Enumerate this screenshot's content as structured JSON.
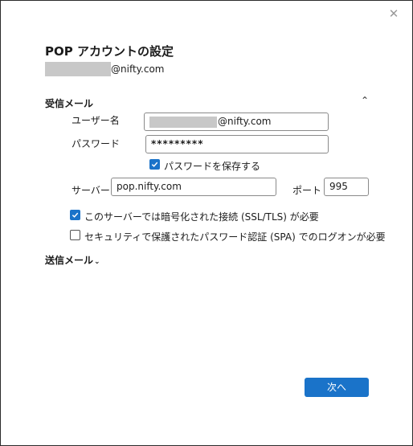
{
  "dialog": {
    "title": "POP アカウントの設定",
    "email_suffix": "@nifty.com"
  },
  "incoming": {
    "heading": "受信メール",
    "username_label": "ユーザー名",
    "username_suffix": "@nifty.com",
    "password_label": "パスワード",
    "password_value": "*********",
    "save_password_label": "パスワードを保存する",
    "save_password_checked": true,
    "server_label": "サーバー",
    "server_value": "pop.nifty.com",
    "port_label": "ポート",
    "port_value": "995",
    "ssl_label": "このサーバーでは暗号化された接続 (SSL/TLS) が必要",
    "ssl_checked": true,
    "spa_label": "セキュリティで保護されたパスワード認証 (SPA) でのログオンが必要",
    "spa_checked": false
  },
  "outgoing": {
    "heading": "送信メール"
  },
  "footer": {
    "next_label": "次へ"
  },
  "icons": {
    "close": "close-icon",
    "collapse": "chevron-up-icon",
    "expand": "chevron-down-icon",
    "check": "checkmark-icon"
  },
  "colors": {
    "accent": "#1a73c9",
    "border": "#8a8a8a"
  }
}
